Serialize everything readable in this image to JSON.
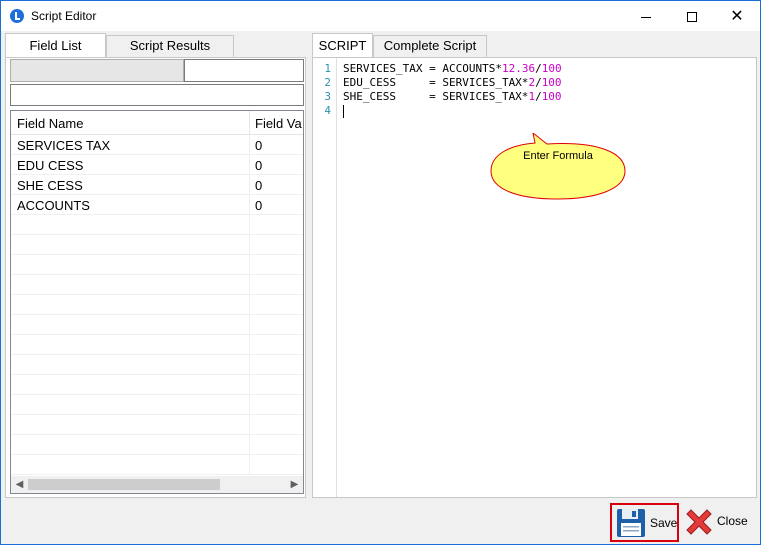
{
  "window": {
    "title": "Script Editor",
    "controls": {
      "minimize": "minimize-icon",
      "maximize": "maximize-icon",
      "close": "close-icon"
    }
  },
  "left_tabs": [
    {
      "label": "Field List",
      "active": true
    },
    {
      "label": "Script Results",
      "active": false
    }
  ],
  "field_grid": {
    "columns": [
      "Field Name",
      "Field Va"
    ],
    "rows": [
      {
        "name": "SERVICES TAX",
        "value": "0"
      },
      {
        "name": "EDU CESS",
        "value": "0"
      },
      {
        "name": "SHE CESS",
        "value": "0"
      },
      {
        "name": "ACCOUNTS",
        "value": "0"
      }
    ]
  },
  "right_tabs": [
    {
      "label": "SCRIPT",
      "active": true
    },
    {
      "label": "Complete Script",
      "active": false
    }
  ],
  "editor": {
    "line_numbers": [
      "1",
      "2",
      "3",
      "4"
    ],
    "lines": [
      {
        "pre": "SERVICES_TAX = ACCOUNTS*",
        "n1": "12.36",
        "mid": "/",
        "n2": "100"
      },
      {
        "pre": "EDU_CESS     = SERVICES_TAX*",
        "n1": "2",
        "mid": "/",
        "n2": "100"
      },
      {
        "pre": "SHE_CESS     = SERVICES_TAX*",
        "n1": "1",
        "mid": "/",
        "n2": "100"
      }
    ]
  },
  "callout": {
    "text": "Enter  Formula",
    "fill": "#ffff80",
    "stroke": "#e00000"
  },
  "buttons": {
    "save": {
      "label": "Save",
      "icon": "floppy-disk-icon"
    },
    "close": {
      "label": "Close",
      "icon": "red-x-icon"
    }
  },
  "colors": {
    "window_border": "#1a6fd6",
    "number_literal": "#c800c8",
    "line_number": "#2b91af",
    "save_highlight": "#d9000d"
  }
}
